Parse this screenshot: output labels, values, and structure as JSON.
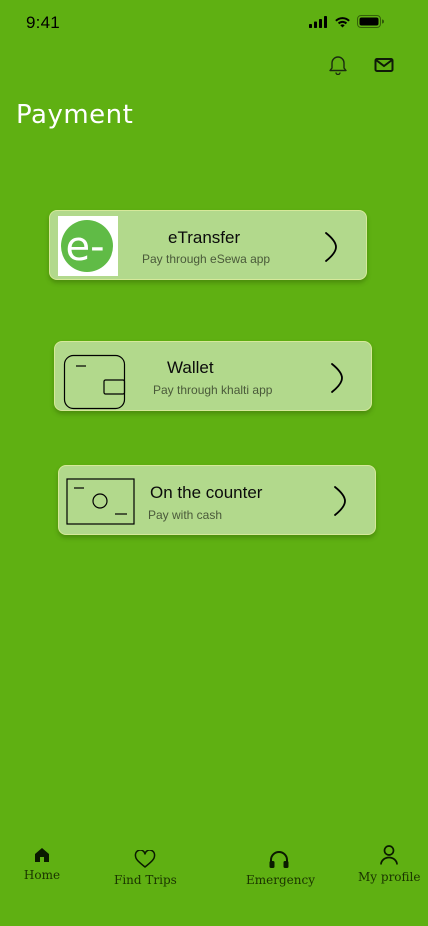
{
  "status_bar": {
    "time": "9:41",
    "icons": [
      "signal-icon",
      "wifi-icon",
      "battery-icon"
    ]
  },
  "header": {
    "icons": [
      "bell-icon",
      "mail-icon"
    ]
  },
  "page": {
    "title": "Payment"
  },
  "payment_options": [
    {
      "title": "eTransfer",
      "subtitle": "Pay through eSewa app",
      "icon": "esewa-logo",
      "logo_text": "e-",
      "logo_color": "#60bb46"
    },
    {
      "title": "Wallet",
      "subtitle": "Pay through khalti app",
      "icon": "wallet-icon"
    },
    {
      "title": "On the counter",
      "subtitle": "Pay with cash",
      "icon": "cash-icon"
    }
  ],
  "bottom_nav": {
    "items": [
      {
        "label": "Home",
        "icon": "home-icon",
        "active": true
      },
      {
        "label": "Find Trips",
        "icon": "heart-icon",
        "active": false
      },
      {
        "label": "Emergency",
        "icon": "headphones-icon",
        "active": false
      },
      {
        "label": "My profile",
        "icon": "user-icon",
        "active": false
      }
    ]
  },
  "colors": {
    "background": "#5fb012",
    "card": "#b2d98c",
    "title_text": "#ffffff"
  }
}
